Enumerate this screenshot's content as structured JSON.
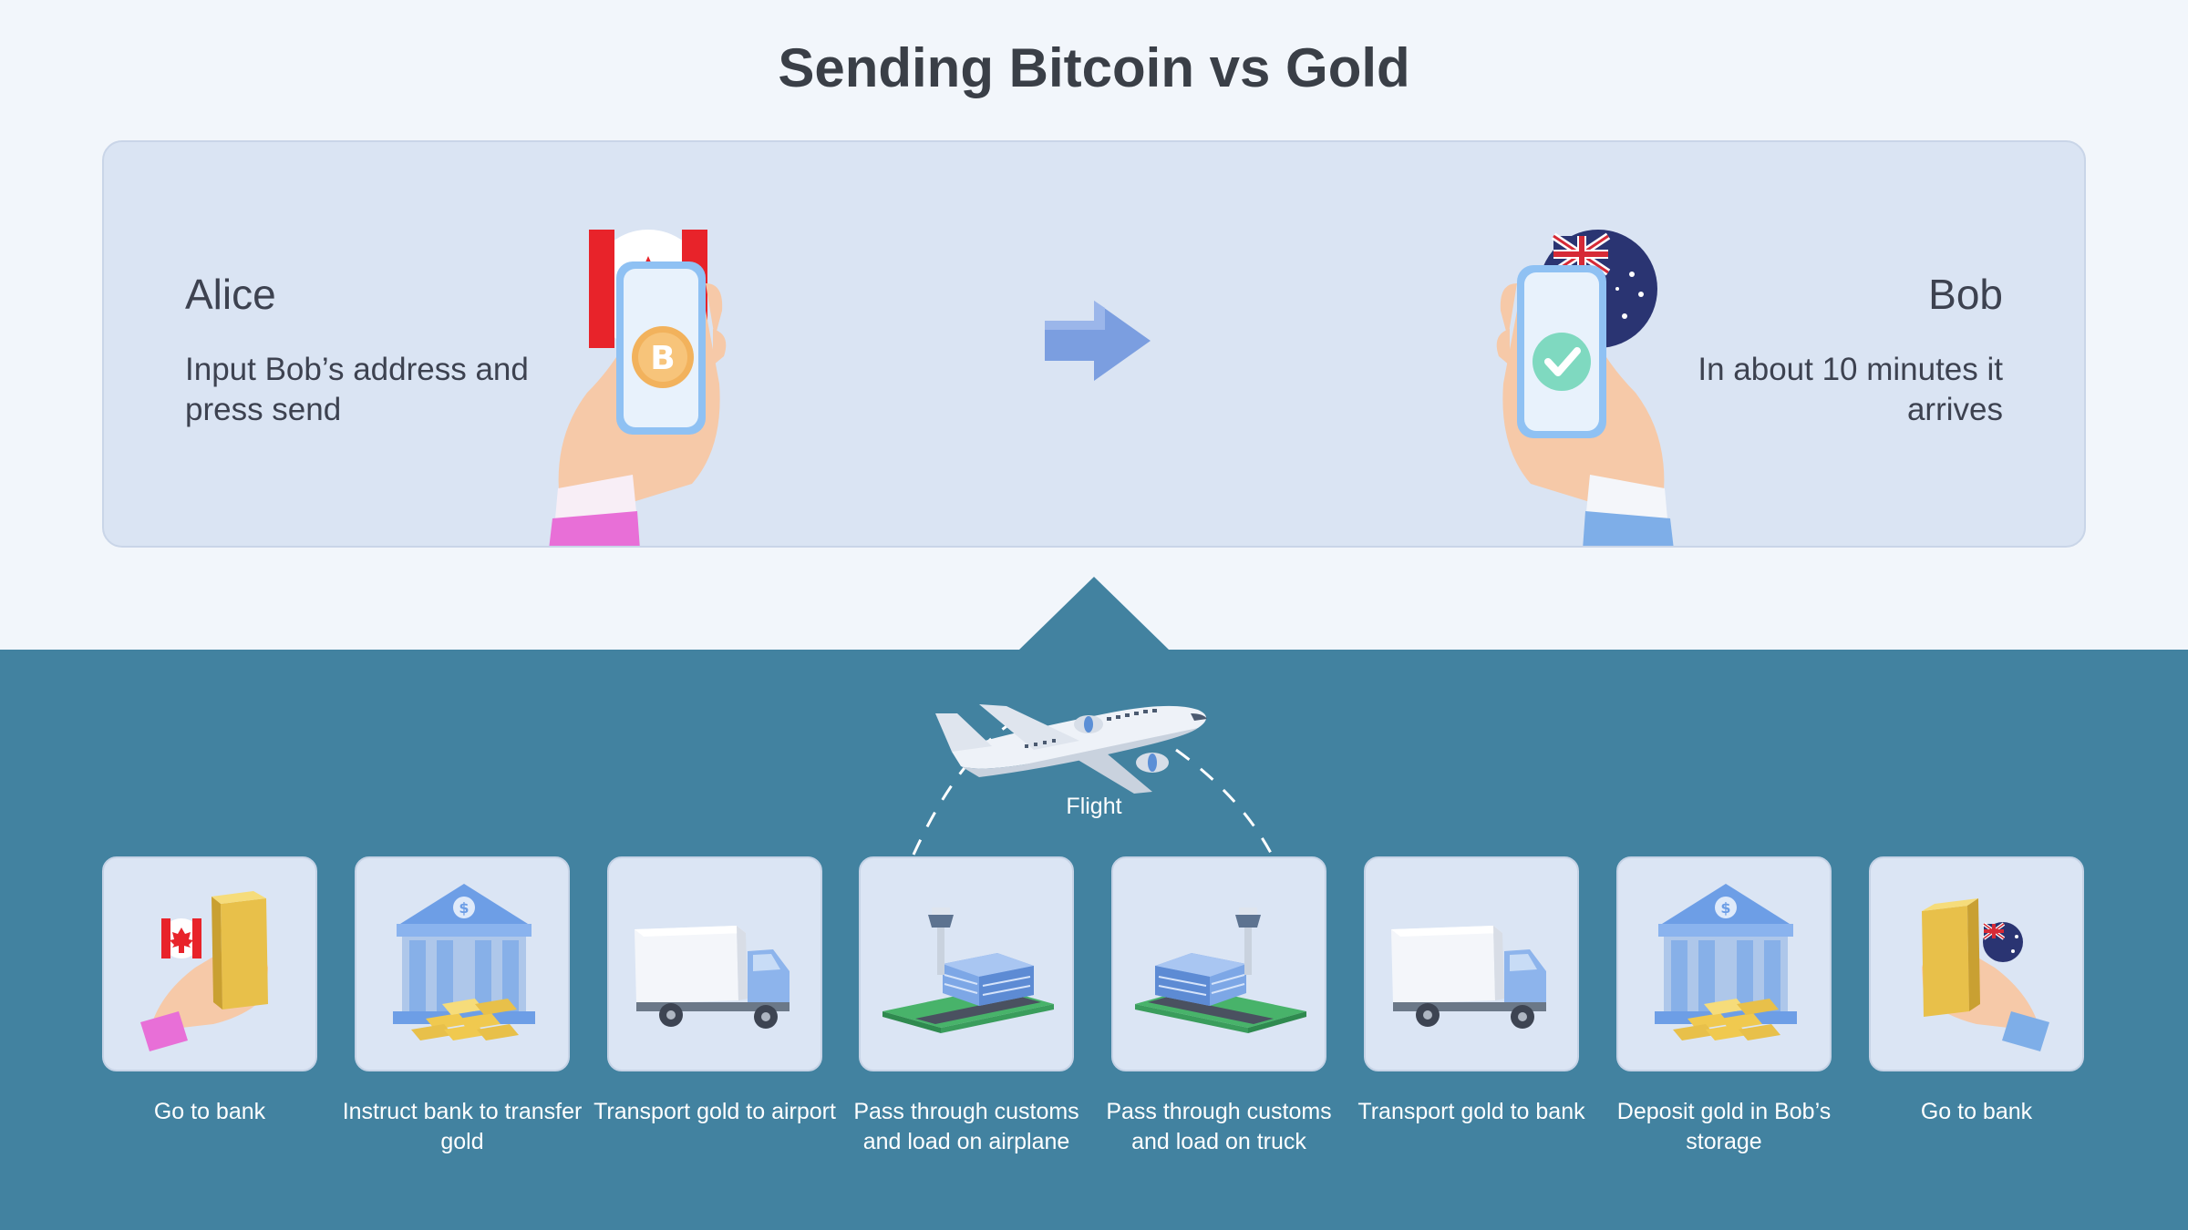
{
  "title": "Sending Bitcoin vs Gold",
  "alice": {
    "name": "Alice",
    "desc": "Input Bob’s address and press send"
  },
  "bob": {
    "name": "Bob",
    "desc": "In about 10 minutes it arrives"
  },
  "flight_label": "Flight",
  "steps": [
    {
      "label": "Go to bank",
      "icon": "hand-gold-bar-canada-icon"
    },
    {
      "label": "Instruct bank to transfer gold",
      "icon": "bank-gold-icon"
    },
    {
      "label": "Transport gold to airport",
      "icon": "truck-icon"
    },
    {
      "label": "Pass through customs and load on airplane",
      "icon": "airport-icon"
    },
    {
      "label": "Pass through customs and load on truck",
      "icon": "airport-icon"
    },
    {
      "label": "Transport gold to bank",
      "icon": "truck-icon"
    },
    {
      "label": "Deposit gold in Bob’s storage",
      "icon": "bank-gold-icon"
    },
    {
      "label": "Go to bank",
      "icon": "hand-gold-bar-australia-icon"
    }
  ],
  "colors": {
    "background": "#f2f6fb",
    "top_panel": "#dae4f3",
    "bottom_band": "#4282a0",
    "card": "#dbe5f4",
    "arrow": "#7b9ee0",
    "gold": "#e8c04a"
  }
}
